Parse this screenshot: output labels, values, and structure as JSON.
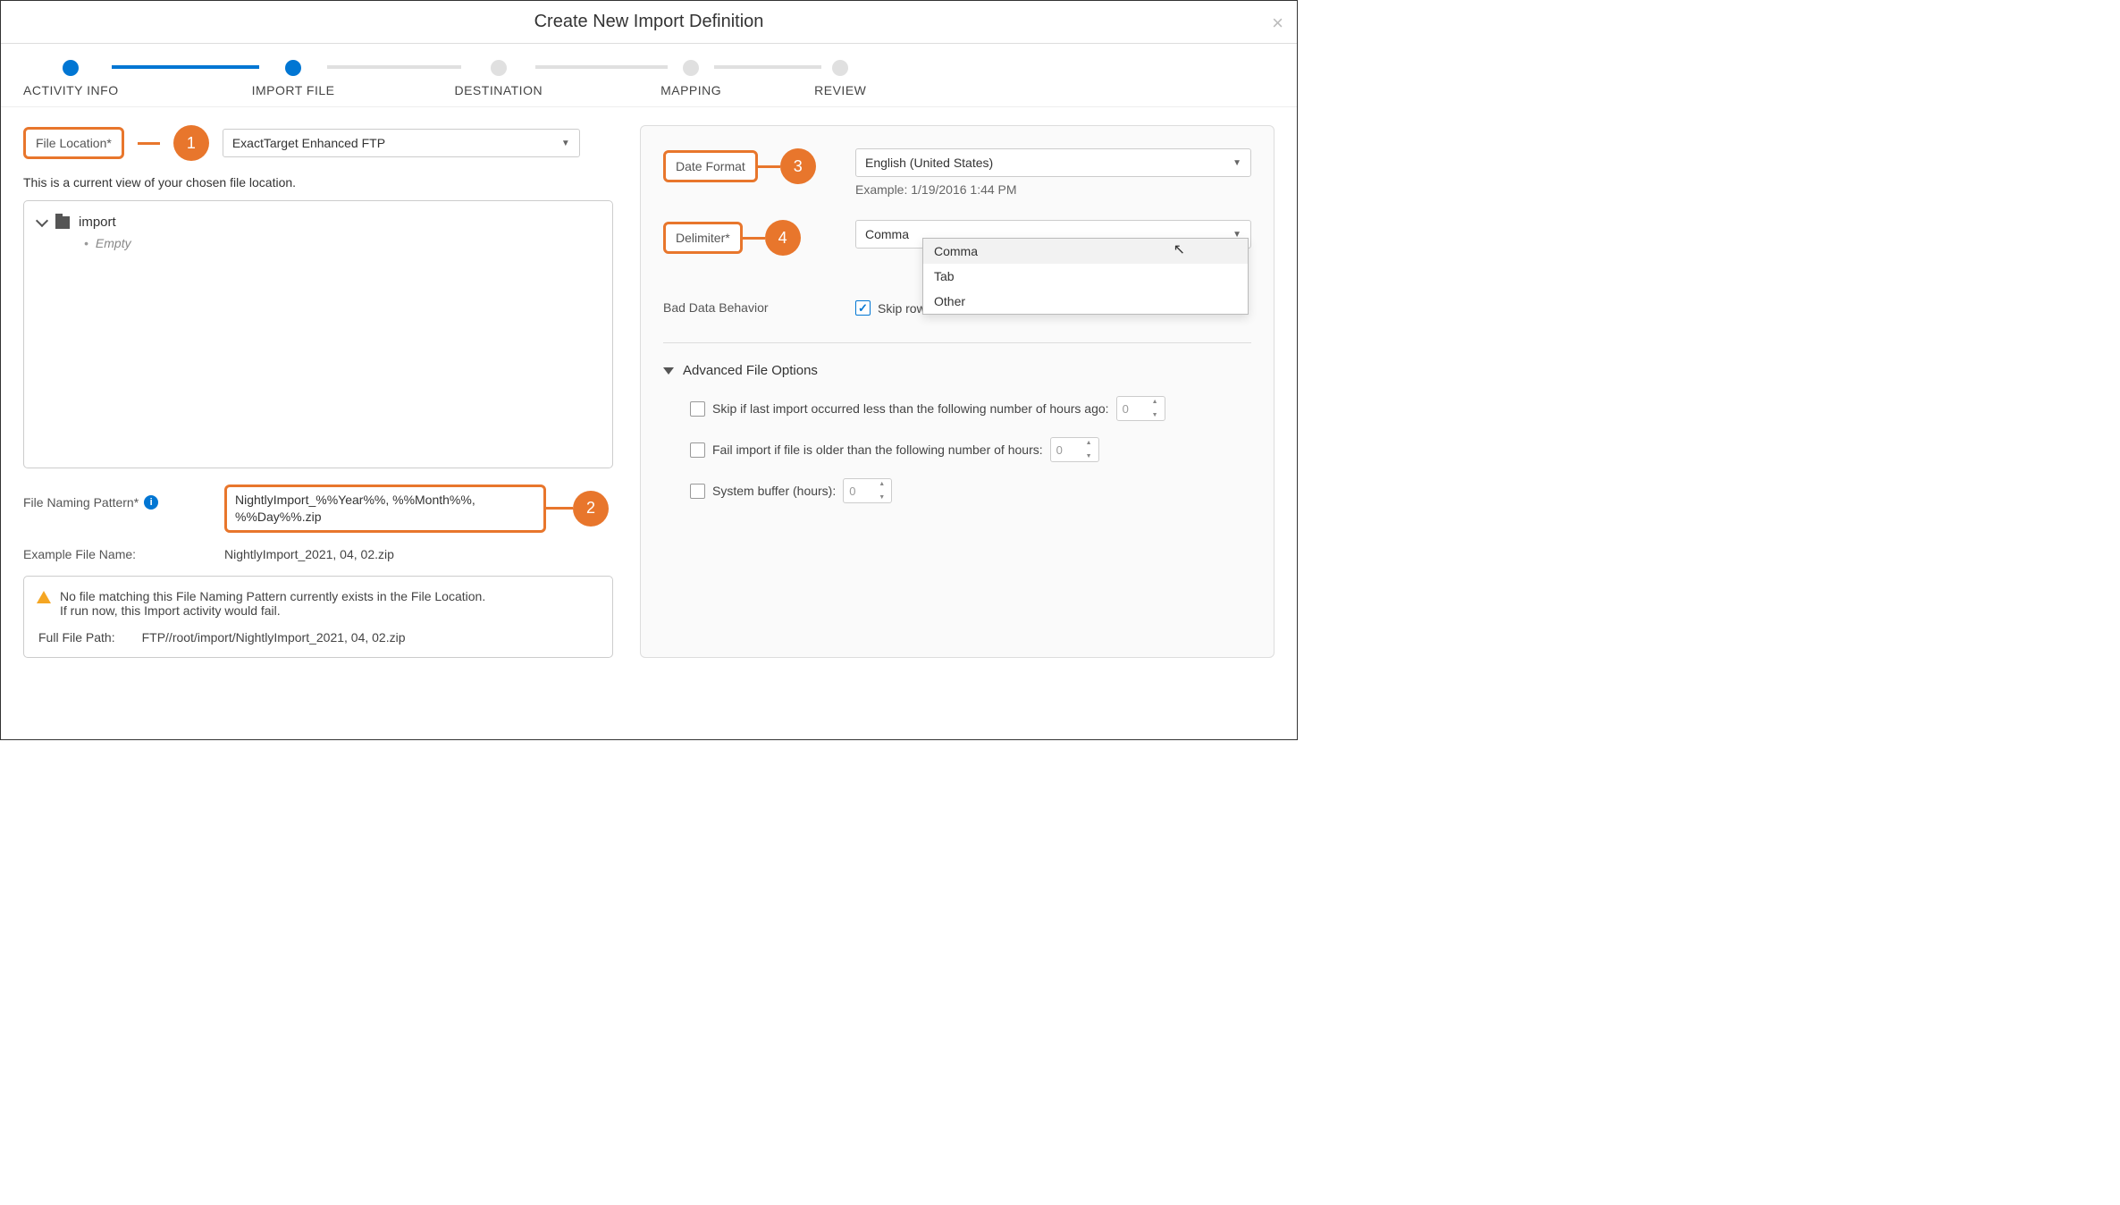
{
  "modal": {
    "title": "Create New Import Definition",
    "close": "×"
  },
  "stepper": {
    "steps": [
      "ACTIVITY INFO",
      "IMPORT FILE",
      "DESTINATION",
      "MAPPING",
      "REVIEW"
    ]
  },
  "left": {
    "file_location_label": "File Location*",
    "file_location_value": "ExactTarget Enhanced FTP",
    "file_location_help": "This is a current view of your chosen file location.",
    "tree_root": "import",
    "tree_empty": "Empty",
    "pattern_label": "File Naming Pattern*",
    "pattern_value": "NightlyImport_%%Year%%, %%Month%%, %%Day%%.zip",
    "example_label": "Example File Name:",
    "example_value": "NightlyImport_2021, 04, 02.zip",
    "warn_line1": "No file matching this File Naming Pattern currently exists in the File Location.",
    "warn_line2": "If run now, this Import activity would fail.",
    "path_label": "Full File Path:",
    "path_value": "FTP//root/import/NightlyImport_2021, 04, 02.zip"
  },
  "right": {
    "date_format_label": "Date Format",
    "date_format_value": "English (United States)",
    "date_format_example": "Example: 1/19/2016 1:44 PM",
    "delimiter_label": "Delimiter*",
    "delimiter_value": "Comma",
    "delimiter_options": [
      "Comma",
      "Tab",
      "Other"
    ],
    "bad_data_label": "Bad Data Behavior",
    "bad_data_value": "Skip rows with bad data",
    "advanced_header": "Advanced File Options",
    "adv_skip_hours": "Skip if last import occurred less than the following number of hours ago:",
    "adv_fail_hours": "Fail import if file is older than the following number of hours:",
    "adv_buffer": "System buffer (hours):",
    "num_placeholder": "0"
  },
  "markers": {
    "m1": "1",
    "m2": "2",
    "m3": "3",
    "m4": "4"
  }
}
